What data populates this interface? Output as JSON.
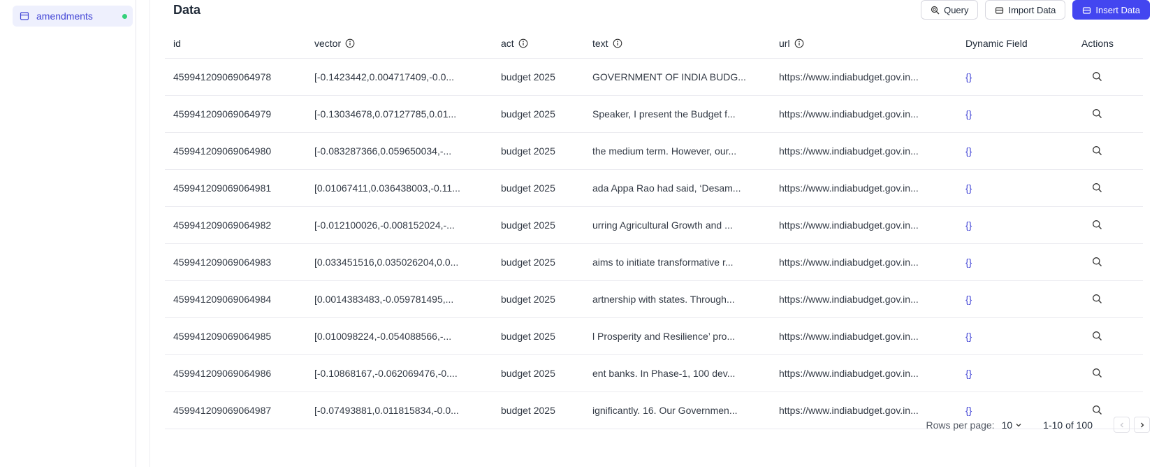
{
  "sidebar": {
    "collection": {
      "name": "amendments",
      "status_color": "#34d17a",
      "icon": "table-icon"
    }
  },
  "section": {
    "title": "Data"
  },
  "toolbar": {
    "query_label": "Query",
    "import_label": "Import Data",
    "insert_label": "Insert Data"
  },
  "columns": {
    "id": "id",
    "vector": "vector",
    "act": "act",
    "text": "text",
    "url": "url",
    "dynamic": "Dynamic Field",
    "actions": "Actions"
  },
  "rows": [
    {
      "id": "459941209069064978",
      "vector": "[-0.1423442,0.004717409,-0.0...",
      "act": "budget 2025",
      "text": "GOVERNMENT OF INDIA BUDG...",
      "url": "https://www.indiabudget.gov.in...",
      "dynamic": "{}"
    },
    {
      "id": "459941209069064979",
      "vector": "[-0.13034678,0.07127785,0.01...",
      "act": "budget 2025",
      "text": "Speaker, I present the Budget f...",
      "url": "https://www.indiabudget.gov.in...",
      "dynamic": "{}"
    },
    {
      "id": "459941209069064980",
      "vector": "[-0.083287366,0.059650034,-...",
      "act": "budget 2025",
      "text": "the medium term. However, our...",
      "url": "https://www.indiabudget.gov.in...",
      "dynamic": "{}"
    },
    {
      "id": "459941209069064981",
      "vector": "[0.01067411,0.036438003,-0.11...",
      "act": "budget 2025",
      "text": "ada Appa Rao had said, ‘Desam...",
      "url": "https://www.indiabudget.gov.in...",
      "dynamic": "{}"
    },
    {
      "id": "459941209069064982",
      "vector": "[-0.012100026,-0.008152024,-...",
      "act": "budget 2025",
      "text": "urring Agricultural Growth and ...",
      "url": "https://www.indiabudget.gov.in...",
      "dynamic": "{}"
    },
    {
      "id": "459941209069064983",
      "vector": "[0.033451516,0.035026204,0.0...",
      "act": "budget 2025",
      "text": "aims to initiate transformative r...",
      "url": "https://www.indiabudget.gov.in...",
      "dynamic": "{}"
    },
    {
      "id": "459941209069064984",
      "vector": "[0.0014383483,-0.059781495,...",
      "act": "budget 2025",
      "text": "artnership with states. Through...",
      "url": "https://www.indiabudget.gov.in...",
      "dynamic": "{}"
    },
    {
      "id": "459941209069064985",
      "vector": "[0.010098224,-0.054088566,-...",
      "act": "budget 2025",
      "text": "l Prosperity and Resilience’ pro...",
      "url": "https://www.indiabudget.gov.in...",
      "dynamic": "{}"
    },
    {
      "id": "459941209069064986",
      "vector": "[-0.10868167,-0.062069476,-0....",
      "act": "budget 2025",
      "text": "ent banks. In Phase-1, 100 dev...",
      "url": "https://www.indiabudget.gov.in...",
      "dynamic": "{}"
    },
    {
      "id": "459941209069064987",
      "vector": "[-0.07493881,0.011815834,-0.0...",
      "act": "budget 2025",
      "text": "ignificantly. 16. Our Governmen...",
      "url": "https://www.indiabudget.gov.in...",
      "dynamic": "{}"
    }
  ],
  "pagination": {
    "rows_per_page_label": "Rows per page:",
    "rows_per_page": "10",
    "range": "1-10 of 100"
  },
  "colors": {
    "accent": "#4346f0",
    "accent_text": "#4346d6",
    "status": "#34d17a"
  }
}
